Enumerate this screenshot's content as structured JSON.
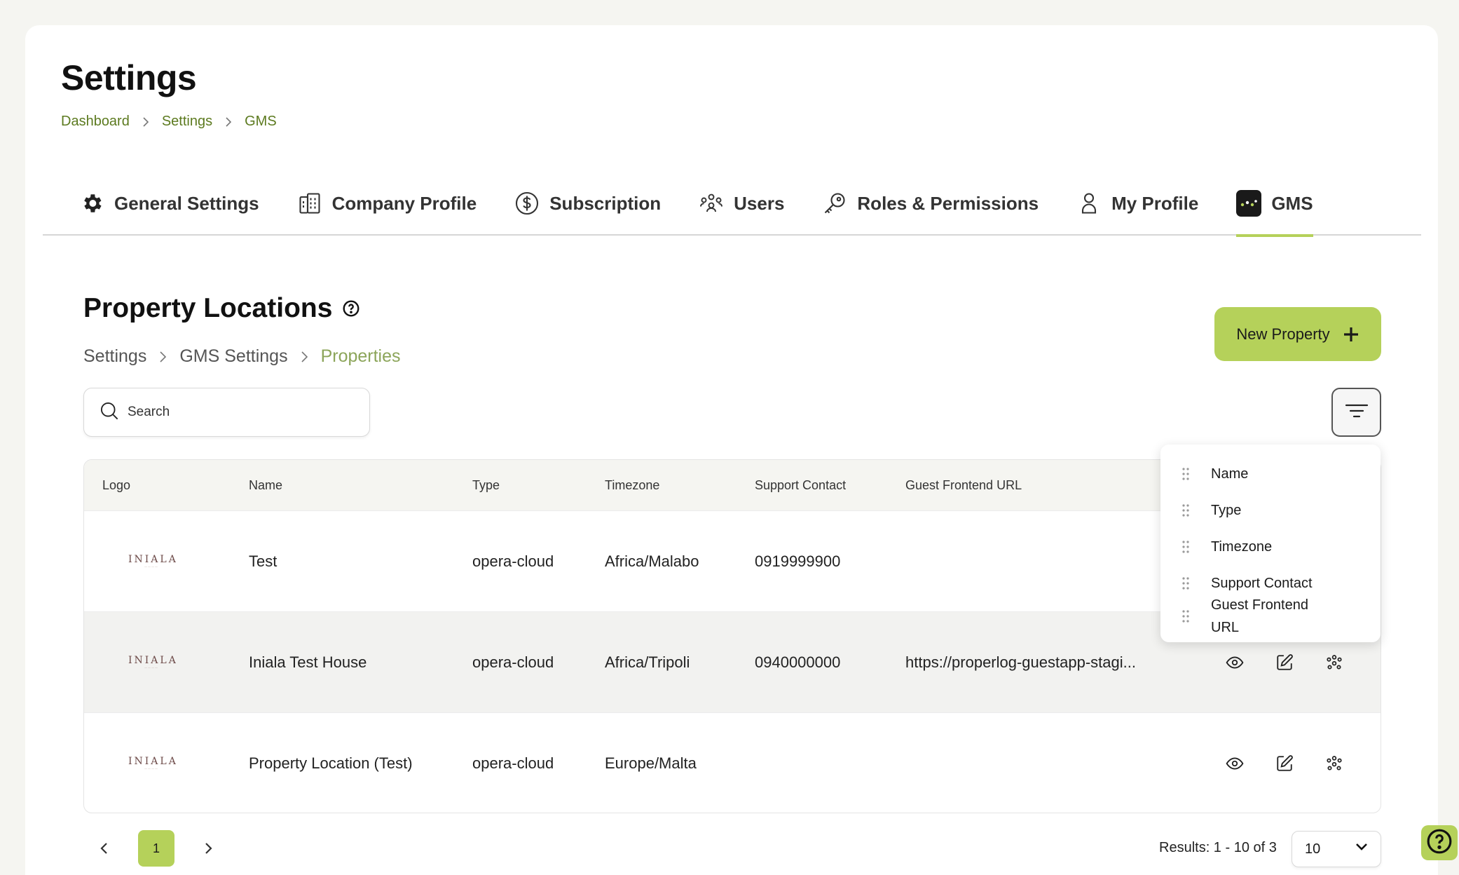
{
  "page": {
    "title": "Settings",
    "breadcrumb": [
      "Dashboard",
      "Settings",
      "GMS"
    ]
  },
  "tabs": [
    {
      "label": "General Settings",
      "icon": "gear-icon"
    },
    {
      "label": "Company Profile",
      "icon": "building-icon"
    },
    {
      "label": "Subscription",
      "icon": "dollar-circle-icon"
    },
    {
      "label": "Users",
      "icon": "users-icon"
    },
    {
      "label": "Roles & Permissions",
      "icon": "key-icon"
    },
    {
      "label": "My Profile",
      "icon": "user-icon"
    },
    {
      "label": "GMS",
      "icon": "gms-logo-icon",
      "active": true
    }
  ],
  "section": {
    "title": "Property Locations",
    "breadcrumb": [
      "Settings",
      "GMS Settings",
      "Properties"
    ],
    "new_button": "New Property",
    "search_placeholder": "Search"
  },
  "table": {
    "columns": [
      "Logo",
      "Name",
      "Type",
      "Timezone",
      "Support Contact",
      "Guest Frontend URL"
    ],
    "rows": [
      {
        "logo": "INIALA",
        "name": "Test",
        "type": "opera-cloud",
        "timezone": "Africa/Malabo",
        "support": "0919999900",
        "url": ""
      },
      {
        "logo": "INIALA",
        "name": "Iniala Test House",
        "type": "opera-cloud",
        "timezone": "Africa/Tripoli",
        "support": "0940000000",
        "url": "https://properlog-guestapp-stagi..."
      },
      {
        "logo": "INIALA",
        "name": "Property Location (Test)",
        "type": "opera-cloud",
        "timezone": "Europe/Malta",
        "support": "",
        "url": ""
      }
    ]
  },
  "column_menu": {
    "items": [
      "Name",
      "Type",
      "Timezone",
      "Support Contact",
      "Guest Frontend URL"
    ]
  },
  "pagination": {
    "current_page": "1",
    "results": "Results: 1 - 10 of 3",
    "per_page": "10"
  },
  "colors": {
    "accent": "#b5d15a",
    "breadcrumb_link": "#5c7a1f",
    "logo_text": "#6d4a48"
  }
}
